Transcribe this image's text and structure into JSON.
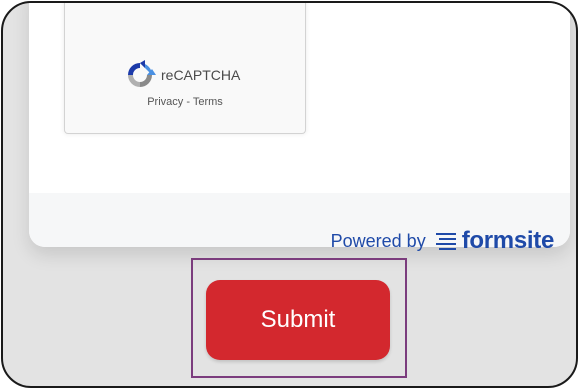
{
  "recaptcha": {
    "brand": "reCAPTCHA",
    "privacy_label": "Privacy",
    "separator": " - ",
    "terms_label": "Terms",
    "icon": "recaptcha-logo-icon"
  },
  "footer": {
    "powered_label": "Powered by",
    "brand": "formsite",
    "icon": "formsite-lines-icon",
    "brand_color": "#1f4aa8"
  },
  "submit": {
    "label": "Submit",
    "color": "#d3282e"
  },
  "highlight_color": "#7b3c7d"
}
